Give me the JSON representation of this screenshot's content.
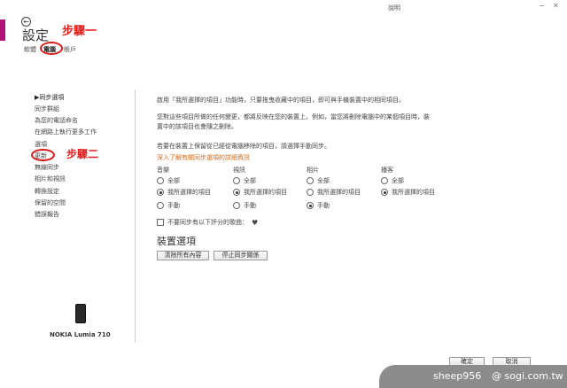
{
  "window": {
    "title": "說明",
    "minimize_glyph": "−",
    "close_glyph": "✕"
  },
  "header": {
    "back_glyph": "←",
    "title": "設定",
    "tabs": [
      {
        "label": "軟體"
      },
      {
        "label": "電腦"
      },
      {
        "label": "帳戶"
      }
    ],
    "active_tab": "電腦"
  },
  "annotations": {
    "step1": "步驟一",
    "step2": "步驟二",
    "color": "#e32020"
  },
  "sidebar": {
    "items": [
      {
        "label": "▶同步選項"
      },
      {
        "label": "同步群組"
      },
      {
        "label": "為您的電話命名"
      },
      {
        "label": "在網路上執行更多工作"
      },
      {
        "label": "選項"
      },
      {
        "label": "更新"
      },
      {
        "label": "無線同步"
      },
      {
        "label": "相片和視訊"
      },
      {
        "label": "轉換設定"
      },
      {
        "label": "保留的空間"
      },
      {
        "label": "錯誤報告"
      }
    ],
    "device_name": "NOKIA Lumia 710"
  },
  "main": {
    "desc1": "啟用「我所選擇的項目」功能時，只要拖曳收藏中的項目，即可與手機裝置中的相同項目。",
    "desc2": "您對這些項目所做的任何變更，都將反映在您的裝置上。例如，當您將刪除電腦中的某個項目時，裝",
    "desc3": "置中的該項目也會隨之刪除。",
    "desc4": "若要在裝置上保留從已經從電腦移除的項目，請選擇手動同步。",
    "link": "深入了解有關同步選項的詳細資訊",
    "columns": [
      {
        "header": "音樂",
        "options": [
          "全部",
          "我所選擇的項目",
          "手動"
        ],
        "selected": 1
      },
      {
        "header": "視訊",
        "options": [
          "全部",
          "我所選擇的項目",
          "手動"
        ],
        "selected": 1
      },
      {
        "header": "相片",
        "options": [
          "全部",
          "我所選擇的項目",
          "手動"
        ],
        "selected": 2
      },
      {
        "header": "播客",
        "options": [
          "全部",
          "我所選擇的項目"
        ],
        "selected": 1
      }
    ],
    "checkbox_label": "不要同步有以下評分的歌曲：",
    "heart_glyph": "♥",
    "device_options_title": "裝置選項",
    "btn_erase": "清除所有內容",
    "btn_stop_sync": "停止同步關係",
    "ok": "確定",
    "cancel": "取消"
  },
  "watermark": {
    "user": "sheep956",
    "site": "@ sogi.com.tw"
  }
}
